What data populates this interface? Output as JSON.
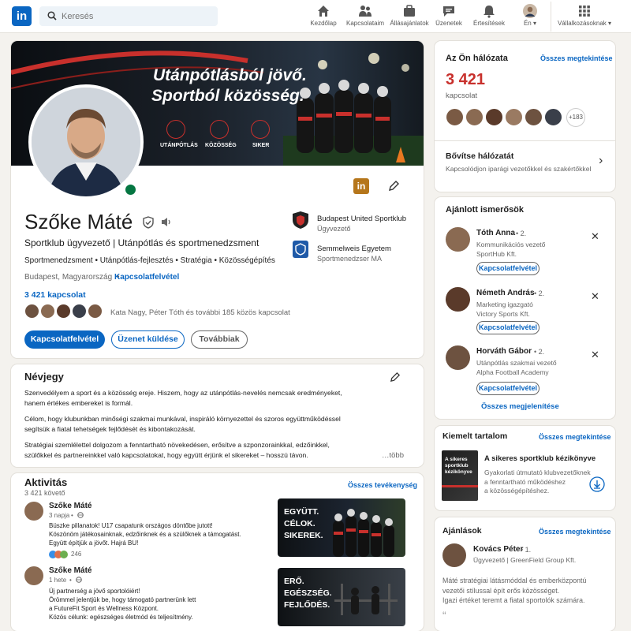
{
  "nav": {
    "search_placeholder": "Keresés",
    "items": [
      {
        "label": "Kezdőlap",
        "icon": "home-icon"
      },
      {
        "label": "Kapcsolataim",
        "icon": "network-icon"
      },
      {
        "label": "Állásajánlatok",
        "icon": "jobs-icon"
      },
      {
        "label": "Üzenetek",
        "icon": "messaging-icon"
      },
      {
        "label": "Értesítések",
        "icon": "bell-icon"
      },
      {
        "label": "Én",
        "icon": "me-avatar"
      },
      {
        "label": "Vállalkozásoknak",
        "icon": "grid-icon"
      }
    ]
  },
  "banner": {
    "line1": "Utánpótlásból jövő.",
    "line2": "Sportból közösség.",
    "badges": [
      "UTÁNPÓTLÁS",
      "KÖZÖSSÉG",
      "SIKER"
    ]
  },
  "profile": {
    "name": "Szőke Máté",
    "headline": "Sportklub ügyvezető | Utánpótlás és sportmenedzsment",
    "skills": "Sportmenedzsment • Utánpótlás-fejlesztés • Stratégia • Közösségépítés",
    "location": "Budapest, Magyarország",
    "location_sep": "•",
    "contact_link": "Kapcsolatfelvétel",
    "connections": "3 421 kapcsolat",
    "mutual": "Kata Nagy, Péter Tóth és további 185 közös kapcsolat",
    "buttons": {
      "connect": "Kapcsolatfelvétel",
      "message": "Üzenet küldése",
      "more": "Továbbiak"
    },
    "experience": [
      {
        "org": "Budapest United Sportklub",
        "role": "Ügyvezető"
      },
      {
        "org": "Semmelweis Egyetem",
        "role": "Sportmenedzser MA"
      }
    ]
  },
  "about": {
    "title": "Névjegy",
    "p1": [
      "Szenvedélyem a sport és a közösség ereje. Hiszem, hogy az utánpótlás-nevelés nemcsak eredményeket,",
      "hanem értékes embereket is formál."
    ],
    "p2": [
      "Célom, hogy klubunkban minőségi szakmai munkával, inspiráló környezettel és szoros együttműködéssel",
      "segítsük a fiatal tehetségek fejlődését és kibontakozását."
    ],
    "p3": [
      "Stratégiai szemlélettel dolgozom a fenntartható növekedésen, erősítve a szponzorainkkal, edzőinkkel,",
      "szülőkkel és partnereinkkel való kapcsolatokat, hogy együtt érjünk el sikereket – hosszú távon."
    ],
    "more": "…több"
  },
  "activity": {
    "title": "Aktivitás",
    "followers": "3 421 követő",
    "see_all": "Összes tevékenység",
    "posts": [
      {
        "author": "Szőke Máté",
        "time": "3 napja",
        "time_sep": "•",
        "lines": [
          "Büszke pillanatok! U17 csapatunk országos döntőbe jutott!",
          "Köszönöm játékosainknak, edzőinknek és a szülőknek a támogatást.",
          "Együtt építjük a jövőt. Hajrá BU!"
        ],
        "reactions": "246",
        "image_text": [
          "EGYÜTT.",
          "CÉLOK.",
          "SIKEREK."
        ]
      },
      {
        "author": "Szőke Máté",
        "time": "1 hete",
        "time_sep": "•",
        "lines": [
          "Új partnerség a jövő sportolóiért!",
          "Örömmel jelentjük be, hogy támogató partnerünk lett",
          "a FutureFit Sport és Wellness Központ.",
          "Közös célunk: egészséges életmód és teljesítmény."
        ],
        "image_text": [
          "ERŐ.",
          "EGÉSZSÉG.",
          "FEJLŐDÉS."
        ]
      }
    ]
  },
  "network": {
    "title": "Az Ön hálózata",
    "see_all": "Összes megtekintése",
    "count": "3 421",
    "count_label": "kapcsolat",
    "extra": "+183",
    "expand_title": "Bővítse hálózatát",
    "expand_sub": "Kapcsolódjon iparági vezetőkkel és szakértőkkel"
  },
  "suggested": {
    "title": "Ajánlott ismerősök",
    "people": [
      {
        "name": "Tóth Anna",
        "degree": "• 2.",
        "role": "Kommunikációs vezető",
        "company": "SportHub Kft.",
        "button": "Kapcsolatfelvétel"
      },
      {
        "name": "Németh András",
        "degree": "• 2.",
        "role": "Marketing igazgató",
        "company": "Victory Sports Kft.",
        "button": "Kapcsolatfelvétel"
      },
      {
        "name": "Horváth Gábor",
        "degree": "• 2.",
        "role": "Utánpótlás szakmai vezető",
        "company": "Alpha Football Academy",
        "button": "Kapcsolatfelvétel"
      }
    ],
    "see_all": "Összes megjelenítése"
  },
  "featured": {
    "title": "Kiemelt tartalom",
    "see_all": "Összes megtekintése",
    "book_cover": [
      "A sikeres",
      "sportklub",
      "kézikönyve"
    ],
    "item_title": "A sikeres sportklub kézikönyve",
    "item_desc": [
      "Gyakorlati útmutató klubvezetőknek",
      "a fenntartható működéshez",
      "a közösségépítéshez."
    ]
  },
  "recommendations": {
    "title": "Ajánlások",
    "see_all": "Összes megtekintése",
    "name": "Kovács Péter",
    "degree": "• 1.",
    "role": "Ügyvezető | GreenField Group Kft.",
    "text": [
      "Máté stratégiai látásmóddal és emberközpontú",
      "vezetői stílussal épít erős közösséget.",
      "Igazi értéket teremt a fiatal sportolók számára."
    ]
  },
  "colors": {
    "brand": "#0a66c2",
    "banner_accent": "#c8302c",
    "online": "#057642",
    "logo_badge": "#b5761b"
  }
}
